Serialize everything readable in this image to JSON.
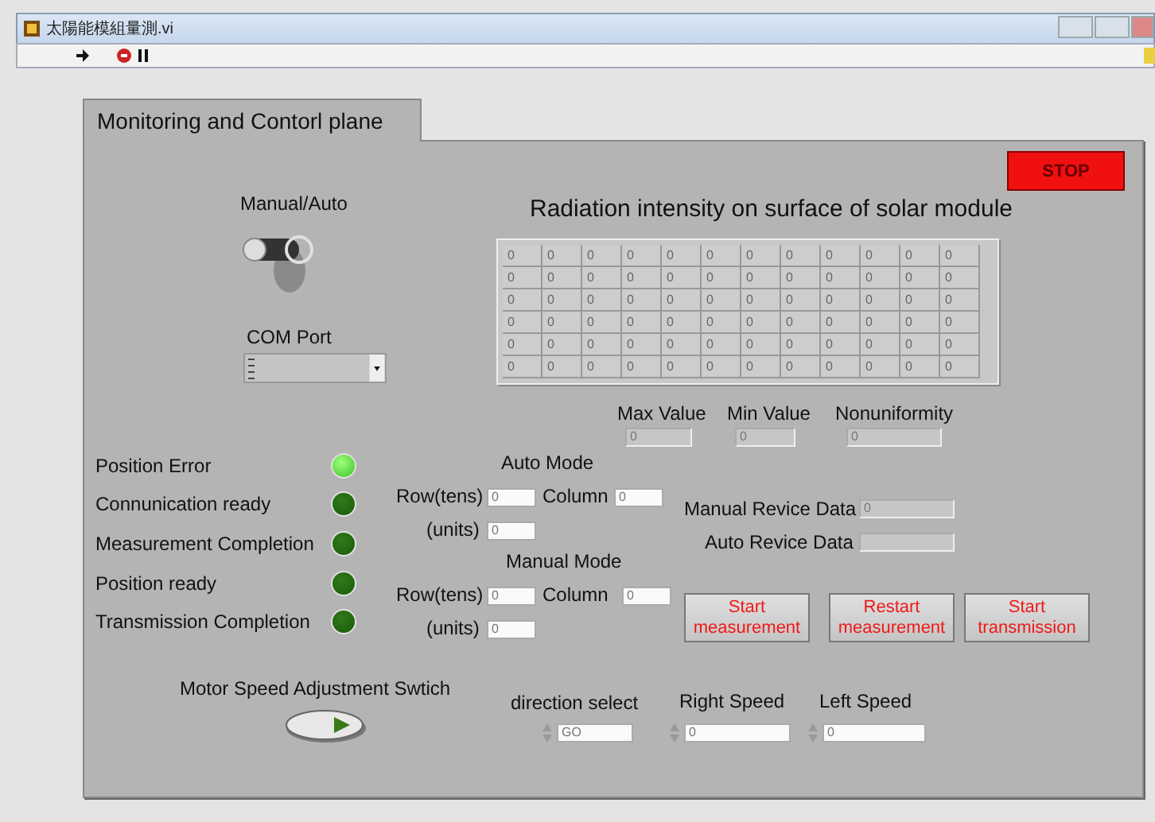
{
  "window": {
    "title": "太陽能模組量測.vi"
  },
  "tab": {
    "label": "Monitoring and Contorl plane",
    "selected": true
  },
  "stop_button": "STOP",
  "manual_auto": {
    "label": "Manual/Auto",
    "on": false
  },
  "com_port": {
    "label": "COM Port"
  },
  "radiation": {
    "title": "Radiation intensity on surface of solar module",
    "rows": [
      [
        "0",
        "0",
        "0",
        "0",
        "0",
        "0",
        "0",
        "0",
        "0",
        "0",
        "0",
        "0"
      ],
      [
        "0",
        "0",
        "0",
        "0",
        "0",
        "0",
        "0",
        "0",
        "0",
        "0",
        "0",
        "0"
      ],
      [
        "0",
        "0",
        "0",
        "0",
        "0",
        "0",
        "0",
        "0",
        "0",
        "0",
        "0",
        "0"
      ],
      [
        "0",
        "0",
        "0",
        "0",
        "0",
        "0",
        "0",
        "0",
        "0",
        "0",
        "0",
        "0"
      ],
      [
        "0",
        "0",
        "0",
        "0",
        "0",
        "0",
        "0",
        "0",
        "0",
        "0",
        "0",
        "0"
      ],
      [
        "0",
        "0",
        "0",
        "0",
        "0",
        "0",
        "0",
        "0",
        "0",
        "0",
        "0",
        "0"
      ]
    ]
  },
  "stats": [
    {
      "label": "Max Value",
      "value": "0"
    },
    {
      "label": "Min Value",
      "value": "0"
    },
    {
      "label": "Nonuniformity",
      "value": "0"
    }
  ],
  "indicators": [
    {
      "label": "Position Error",
      "on": true
    },
    {
      "label": "Connunication ready",
      "on": false
    },
    {
      "label": "Measurement Completion",
      "on": false
    },
    {
      "label": "Position ready",
      "on": false
    },
    {
      "label": "Transmission Completion",
      "on": false
    }
  ],
  "auto_mode": {
    "title": "Auto Mode",
    "row_label": "Row(tens)",
    "row": "0",
    "column_label": "Column",
    "column": "0",
    "units_label": "(units)",
    "units": "0"
  },
  "manual_mode": {
    "title": "Manual Mode",
    "row_label": "Row(tens)",
    "row": "0",
    "column_label": "Column",
    "column": "0",
    "units_label": "(units)",
    "units": "0"
  },
  "revice": [
    {
      "label": "Manual Revice Data",
      "value": "0"
    },
    {
      "label": "Auto Revice Data"
    }
  ],
  "buttons": [
    "Start measurement",
    "Restart measurement",
    "Start transmission"
  ],
  "motor_switch": {
    "label": "Motor Speed Adjustment Swtich",
    "on": true
  },
  "speeds": [
    {
      "label": "direction select",
      "value": "GO"
    },
    {
      "label": "Right Speed",
      "value": "0"
    },
    {
      "label": "Left Speed",
      "value": "0"
    }
  ]
}
